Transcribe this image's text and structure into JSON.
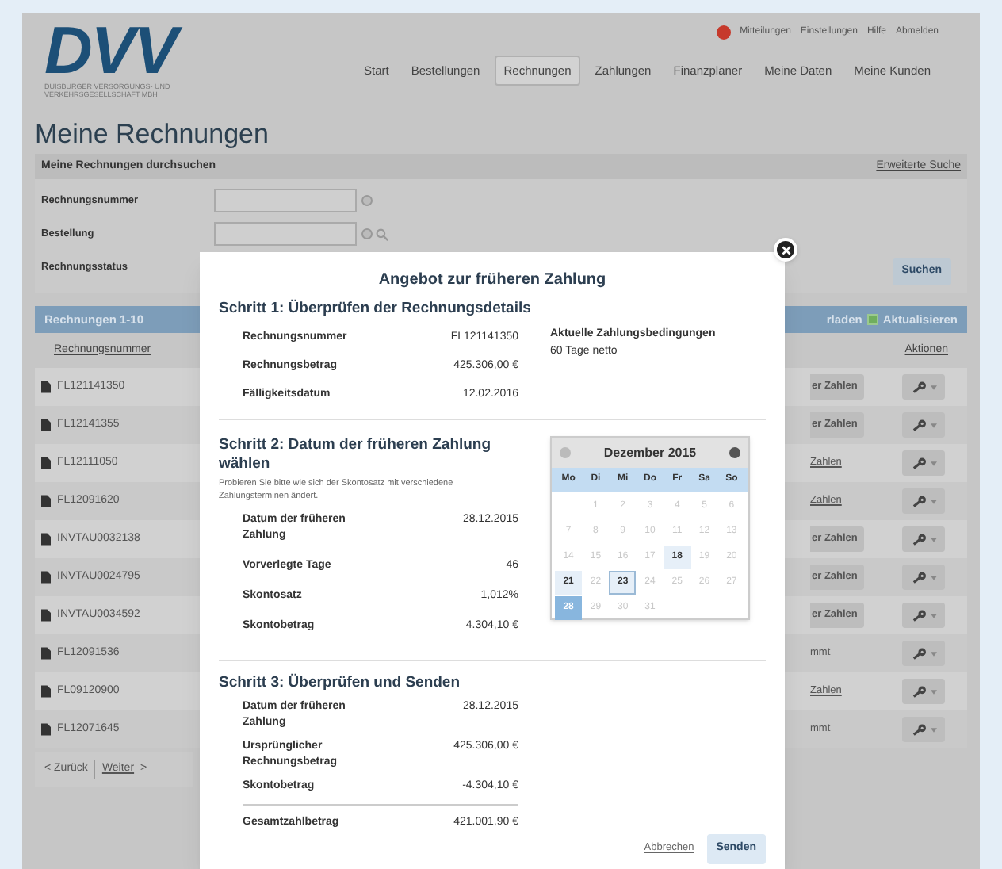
{
  "header": {
    "logo": "DVV",
    "logo_subtitle": "DUISBURGER VERSORGUNGS- UND VERKEHRSGESELLSCHAFT MBH",
    "top_links": [
      "Mitteilungen",
      "Einstellungen",
      "Hilfe",
      "Abmelden"
    ],
    "nav": [
      {
        "label": "Start",
        "selected": false
      },
      {
        "label": "Bestellungen",
        "selected": false
      },
      {
        "label": "Rechnungen",
        "selected": true
      },
      {
        "label": "Zahlungen",
        "selected": false
      },
      {
        "label": "Finanzplaner",
        "selected": false
      },
      {
        "label": "Meine Daten",
        "selected": false
      },
      {
        "label": "Meine Kunden",
        "selected": false
      }
    ]
  },
  "page_title": "Meine Rechnungen",
  "search": {
    "title": "Meine Rechnungen durchsuchen",
    "advanced_link": "Erweiterte Suche",
    "button": "Suchen",
    "fields": [
      {
        "label": "Rechnungsnummer",
        "kind": "info"
      },
      {
        "label": "Bestellung",
        "kind": "lookup"
      },
      {
        "label": "Rechnungsstatus",
        "kind": "covered"
      }
    ]
  },
  "table": {
    "title": "Rechnungen 1-10",
    "toolbar_text": "rladen",
    "refresh": "Aktualisieren",
    "columns": [
      "Rechnungsnummer",
      "Aktionen"
    ],
    "rows": [
      {
        "number": "FL121141350",
        "status": "er Zahlen",
        "kind": "button"
      },
      {
        "number": "FL12141355",
        "status": "er Zahlen",
        "kind": "button"
      },
      {
        "number": "FL12111050",
        "status": "Zahlen",
        "kind": "link"
      },
      {
        "number": "FL12091620",
        "status": "Zahlen",
        "kind": "link"
      },
      {
        "number": "INVTAU0032138",
        "status": "er Zahlen",
        "kind": "button"
      },
      {
        "number": "INVTAU0024795",
        "status": "er Zahlen",
        "kind": "button"
      },
      {
        "number": "INVTAU0034592",
        "status": "er Zahlen",
        "kind": "button"
      },
      {
        "number": "FL12091536",
        "status": "mmt",
        "kind": "text"
      },
      {
        "number": "FL09120900",
        "status": "Zahlen",
        "kind": "link"
      },
      {
        "number": "FL12071645",
        "status": "mmt",
        "kind": "text"
      }
    ]
  },
  "pagination": {
    "previous": "< Zurück",
    "next": "Weiter",
    "next_arrow": ">"
  },
  "modal": {
    "title": "Angebot zur früheren Zahlung",
    "step1": {
      "heading": "Schritt 1: Überprüfen der Rechnungsdetails",
      "rows": [
        {
          "label": "Rechnungsnummer",
          "value": "FL121141350"
        },
        {
          "label": "Rechnungsbetrag",
          "value": "425.306,00 €"
        },
        {
          "label": "Fälligkeitsdatum",
          "value": "12.02.2016"
        }
      ],
      "terms_label": "Aktuelle Zahlungsbedingungen",
      "terms_value": "60 Tage netto"
    },
    "step2": {
      "heading": "Schritt 2: Datum der früheren Zahlung wählen",
      "hint": "Probieren Sie bitte wie sich der Skontosatz mit verschiedene Zahlungsterminen ändert.",
      "rows": [
        {
          "label": "Datum der früheren Zahlung",
          "value": "28.12.2015"
        },
        {
          "label": "Vorverlegte Tage",
          "value": "46"
        },
        {
          "label": "Skontosatz",
          "value": "1,012%"
        },
        {
          "label": "Skontobetrag",
          "value": "4.304,10 €"
        }
      ],
      "calendar": {
        "month": "Dezember 2015",
        "weekdays": [
          "Mo",
          "Di",
          "Mi",
          "Do",
          "Fr",
          "Sa",
          "So"
        ],
        "weeks": [
          [
            {
              "day": "1",
              "disabled": true,
              "selected": false,
              "today": false
            },
            {
              "day": "2",
              "disabled": true,
              "selected": false,
              "today": false
            },
            {
              "day": "3",
              "disabled": true,
              "selected": false,
              "today": false
            },
            {
              "day": "4",
              "disabled": true,
              "selected": false,
              "today": false
            },
            {
              "day": "5",
              "disabled": true,
              "selected": false,
              "today": false
            },
            {
              "day": "6",
              "disabled": true,
              "selected": false,
              "today": false
            }
          ],
          [
            {
              "day": "7",
              "disabled": true,
              "selected": false,
              "today": false
            },
            {
              "day": "8",
              "disabled": true,
              "selected": false,
              "today": false
            },
            {
              "day": "9",
              "disabled": true,
              "selected": false,
              "today": false
            },
            {
              "day": "10",
              "disabled": true,
              "selected": false,
              "today": false
            },
            {
              "day": "11",
              "disabled": true,
              "selected": false,
              "today": false
            },
            {
              "day": "12",
              "disabled": true,
              "selected": false,
              "today": false
            },
            {
              "day": "13",
              "disabled": true,
              "selected": false,
              "today": false
            }
          ],
          [
            {
              "day": "14",
              "disabled": true,
              "selected": false,
              "today": false
            },
            {
              "day": "15",
              "disabled": true,
              "selected": false,
              "today": false
            },
            {
              "day": "16",
              "disabled": true,
              "selected": false,
              "today": false
            },
            {
              "day": "17",
              "disabled": true,
              "selected": false,
              "today": false
            },
            {
              "day": "18",
              "disabled": false,
              "selected": false,
              "today": false
            },
            {
              "day": "19",
              "disabled": true,
              "selected": false,
              "today": false
            },
            {
              "day": "20",
              "disabled": true,
              "selected": false,
              "today": false
            }
          ],
          [
            {
              "day": "21",
              "disabled": false,
              "selected": false,
              "today": false
            },
            {
              "day": "22",
              "disabled": true,
              "selected": false,
              "today": false
            },
            {
              "day": "23",
              "disabled": false,
              "selected": false,
              "today": true
            },
            {
              "day": "24",
              "disabled": true,
              "selected": false,
              "today": false
            },
            {
              "day": "25",
              "disabled": true,
              "selected": false,
              "today": false
            },
            {
              "day": "26",
              "disabled": true,
              "selected": false,
              "today": false
            },
            {
              "day": "27",
              "disabled": true,
              "selected": false,
              "today": false
            }
          ],
          [
            {
              "day": "28",
              "disabled": false,
              "selected": true,
              "today": false
            },
            {
              "day": "29",
              "disabled": true,
              "selected": false,
              "today": false
            },
            {
              "day": "30",
              "disabled": true,
              "selected": false,
              "today": false
            },
            {
              "day": "31",
              "disabled": true,
              "selected": false,
              "today": false
            }
          ]
        ]
      }
    },
    "step3": {
      "heading": "Schritt 3: Überprüfen und Senden",
      "rows": [
        {
          "label": "Datum der früheren Zahlung",
          "value": "28.12.2015",
          "kind": "item"
        },
        {
          "label": "Ursprünglicher Rechnungsbetrag",
          "value": "425.306,00 €",
          "kind": "item"
        },
        {
          "label": "Skontobetrag",
          "value": "-4.304,10 €",
          "kind": "item"
        },
        {
          "label": "Gesamtzahlbetrag",
          "value": "421.001,90 €",
          "kind": "total"
        }
      ]
    },
    "cancel": "Abbrechen",
    "submit": "Senden"
  }
}
